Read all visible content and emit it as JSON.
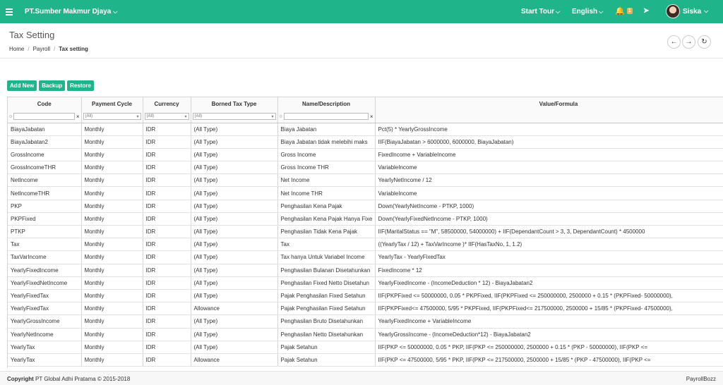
{
  "topbar": {
    "company": "PT.Sumber Makmur Djaya",
    "start_tour": "Start Tour",
    "language": "English",
    "notification_count": "1",
    "user_name": "Siska",
    "accent_color": "#1fb48a"
  },
  "page": {
    "title": "Tax Setting",
    "breadcrumb": [
      "Home",
      "Payroll",
      "Tax setting"
    ]
  },
  "toolbar": {
    "add_new": "Add New",
    "backup": "Backup",
    "restore": "Restore"
  },
  "grid": {
    "columns": [
      "Code",
      "Payment Cycle",
      "Currency",
      "Borned Tax Type",
      "Name/Description",
      "Value/Formula"
    ],
    "filter_all": "(All)",
    "rows": [
      [
        "BiayaJabatan",
        "Monthly",
        "IDR",
        "(All Type)",
        "Biaya Jabatan",
        "Pct(5) * YearlyGrossIncome"
      ],
      [
        "BiayaJabatan2",
        "Monthly",
        "IDR",
        "(All Type)",
        "Biaya Jabatan tidak melebihi maks",
        "IIF(BiayaJabatan > 6000000, 6000000, BiayaJabatan)"
      ],
      [
        "GrossIncome",
        "Monthly",
        "IDR",
        "(All Type)",
        "Gross Income",
        "FixedIncome + VariableIncome"
      ],
      [
        "GrossIncomeTHR",
        "Monthly",
        "IDR",
        "(All Type)",
        "Gross Income THR",
        "VariableIncome"
      ],
      [
        "NetIncome",
        "Monthly",
        "IDR",
        "(All Type)",
        "Net Income",
        "YearlyNetIncome / 12"
      ],
      [
        "NetIncomeTHR",
        "Monthly",
        "IDR",
        "(All Type)",
        "Net Income THR",
        "VariableIncome"
      ],
      [
        "PKP",
        "Monthly",
        "IDR",
        "(All Type)",
        "Penghasilan Kena Pajak",
        "Down(YearlyNetIncome - PTKP, 1000)"
      ],
      [
        "PKPFixed",
        "Monthly",
        "IDR",
        "(All Type)",
        "Penghasilan Kena Pajak Hanya Fixe",
        "Down(YearlyFixedNetIncome  - PTKP, 1000)"
      ],
      [
        "PTKP",
        "Monthly",
        "IDR",
        "(All Type)",
        "Penghasilan Tidak Kena Pajak",
        "IIF(MaritalStatus == \"M\", 58500000, 54000000) + IIF(DependantCount > 3, 3, DependantCount) * 4500000"
      ],
      [
        "Tax",
        "Monthly",
        "IDR",
        "(All Type)",
        "Tax",
        "((YearlyTax / 12)  + TaxVarIncome )* IIF(HasTaxNo, 1, 1.2)"
      ],
      [
        "TaxVarIncome",
        "Monthly",
        "IDR",
        "(All Type)",
        "Tax hanya Untuk Variabel Income",
        "YearlyTax  - YearlyFixedTax"
      ],
      [
        "YearlyFixedIncome",
        "Monthly",
        "IDR",
        "(All Type)",
        "Penghasilan Bulanan Disetahunkan",
        "FixedIncome * 12"
      ],
      [
        "YearlyFixedNetIncome",
        "Monthly",
        "IDR",
        "(All Type)",
        "Penghasilan Fixed Netto Disetahun",
        "YearlyFixedIncome - (IncomeDeduction * 12)  - BiayaJabatan2"
      ],
      [
        "YearlyFixedTax",
        "Monthly",
        "IDR",
        "(All Type)",
        "Pajak Penghasilan Fixed Setahun",
        "IIF(PKPFixed <= 50000000,      0.05 * PKPFixed,      IIF(PKPFixed <= 250000000,          2500000 + 0.15 * (PKPFixed- 50000000),"
      ],
      [
        "YearlyFixedTax",
        "Monthly",
        "IDR",
        "Allowance",
        "Pajak Penghasilan Fixed Setahun",
        "IIF(PKPFixed<= 47500000,      5/95 * PKPFixed,      IIF(PKPFixed<= 217500000,          2500000 + 15/85 * (PKPFixed- 47500000),"
      ],
      [
        "YearlyGrossIncome",
        "Monthly",
        "IDR",
        "(All Type)",
        "Penghasilan Bruto Disetahunkan",
        "YearlyFixedIncome + VariableIncome"
      ],
      [
        "YearlyNetIncome",
        "Monthly",
        "IDR",
        "(All Type)",
        "Penghasilan Netto Disetahunkan",
        "YearlyGrossIncome - (IncomeDeduction*12) - BiayaJabatan2"
      ],
      [
        "YearlyTax",
        "Monthly",
        "IDR",
        "(All Type)",
        "Pajak Setahun",
        "IIF(PKP <= 50000000,      0.05 * PKP,      IIF(PKP <= 250000000,          2500000 + 0.15 * (PKP - 50000000),          IIF(PKP <="
      ],
      [
        "YearlyTax",
        "Monthly",
        "IDR",
        "Allowance",
        "Pajak Setahun",
        "IIF(PKP <= 47500000,      5/95 * PKP,      IIF(PKP <= 217500000,          2500000 + 15/85 * (PKP - 47500000),          IIF(PKP <="
      ]
    ]
  },
  "footer": {
    "copyright_label": "Copyright",
    "copyright_text": "PT Global Adhi Pratama © 2015-2018",
    "brand": "PayrollBozz"
  }
}
